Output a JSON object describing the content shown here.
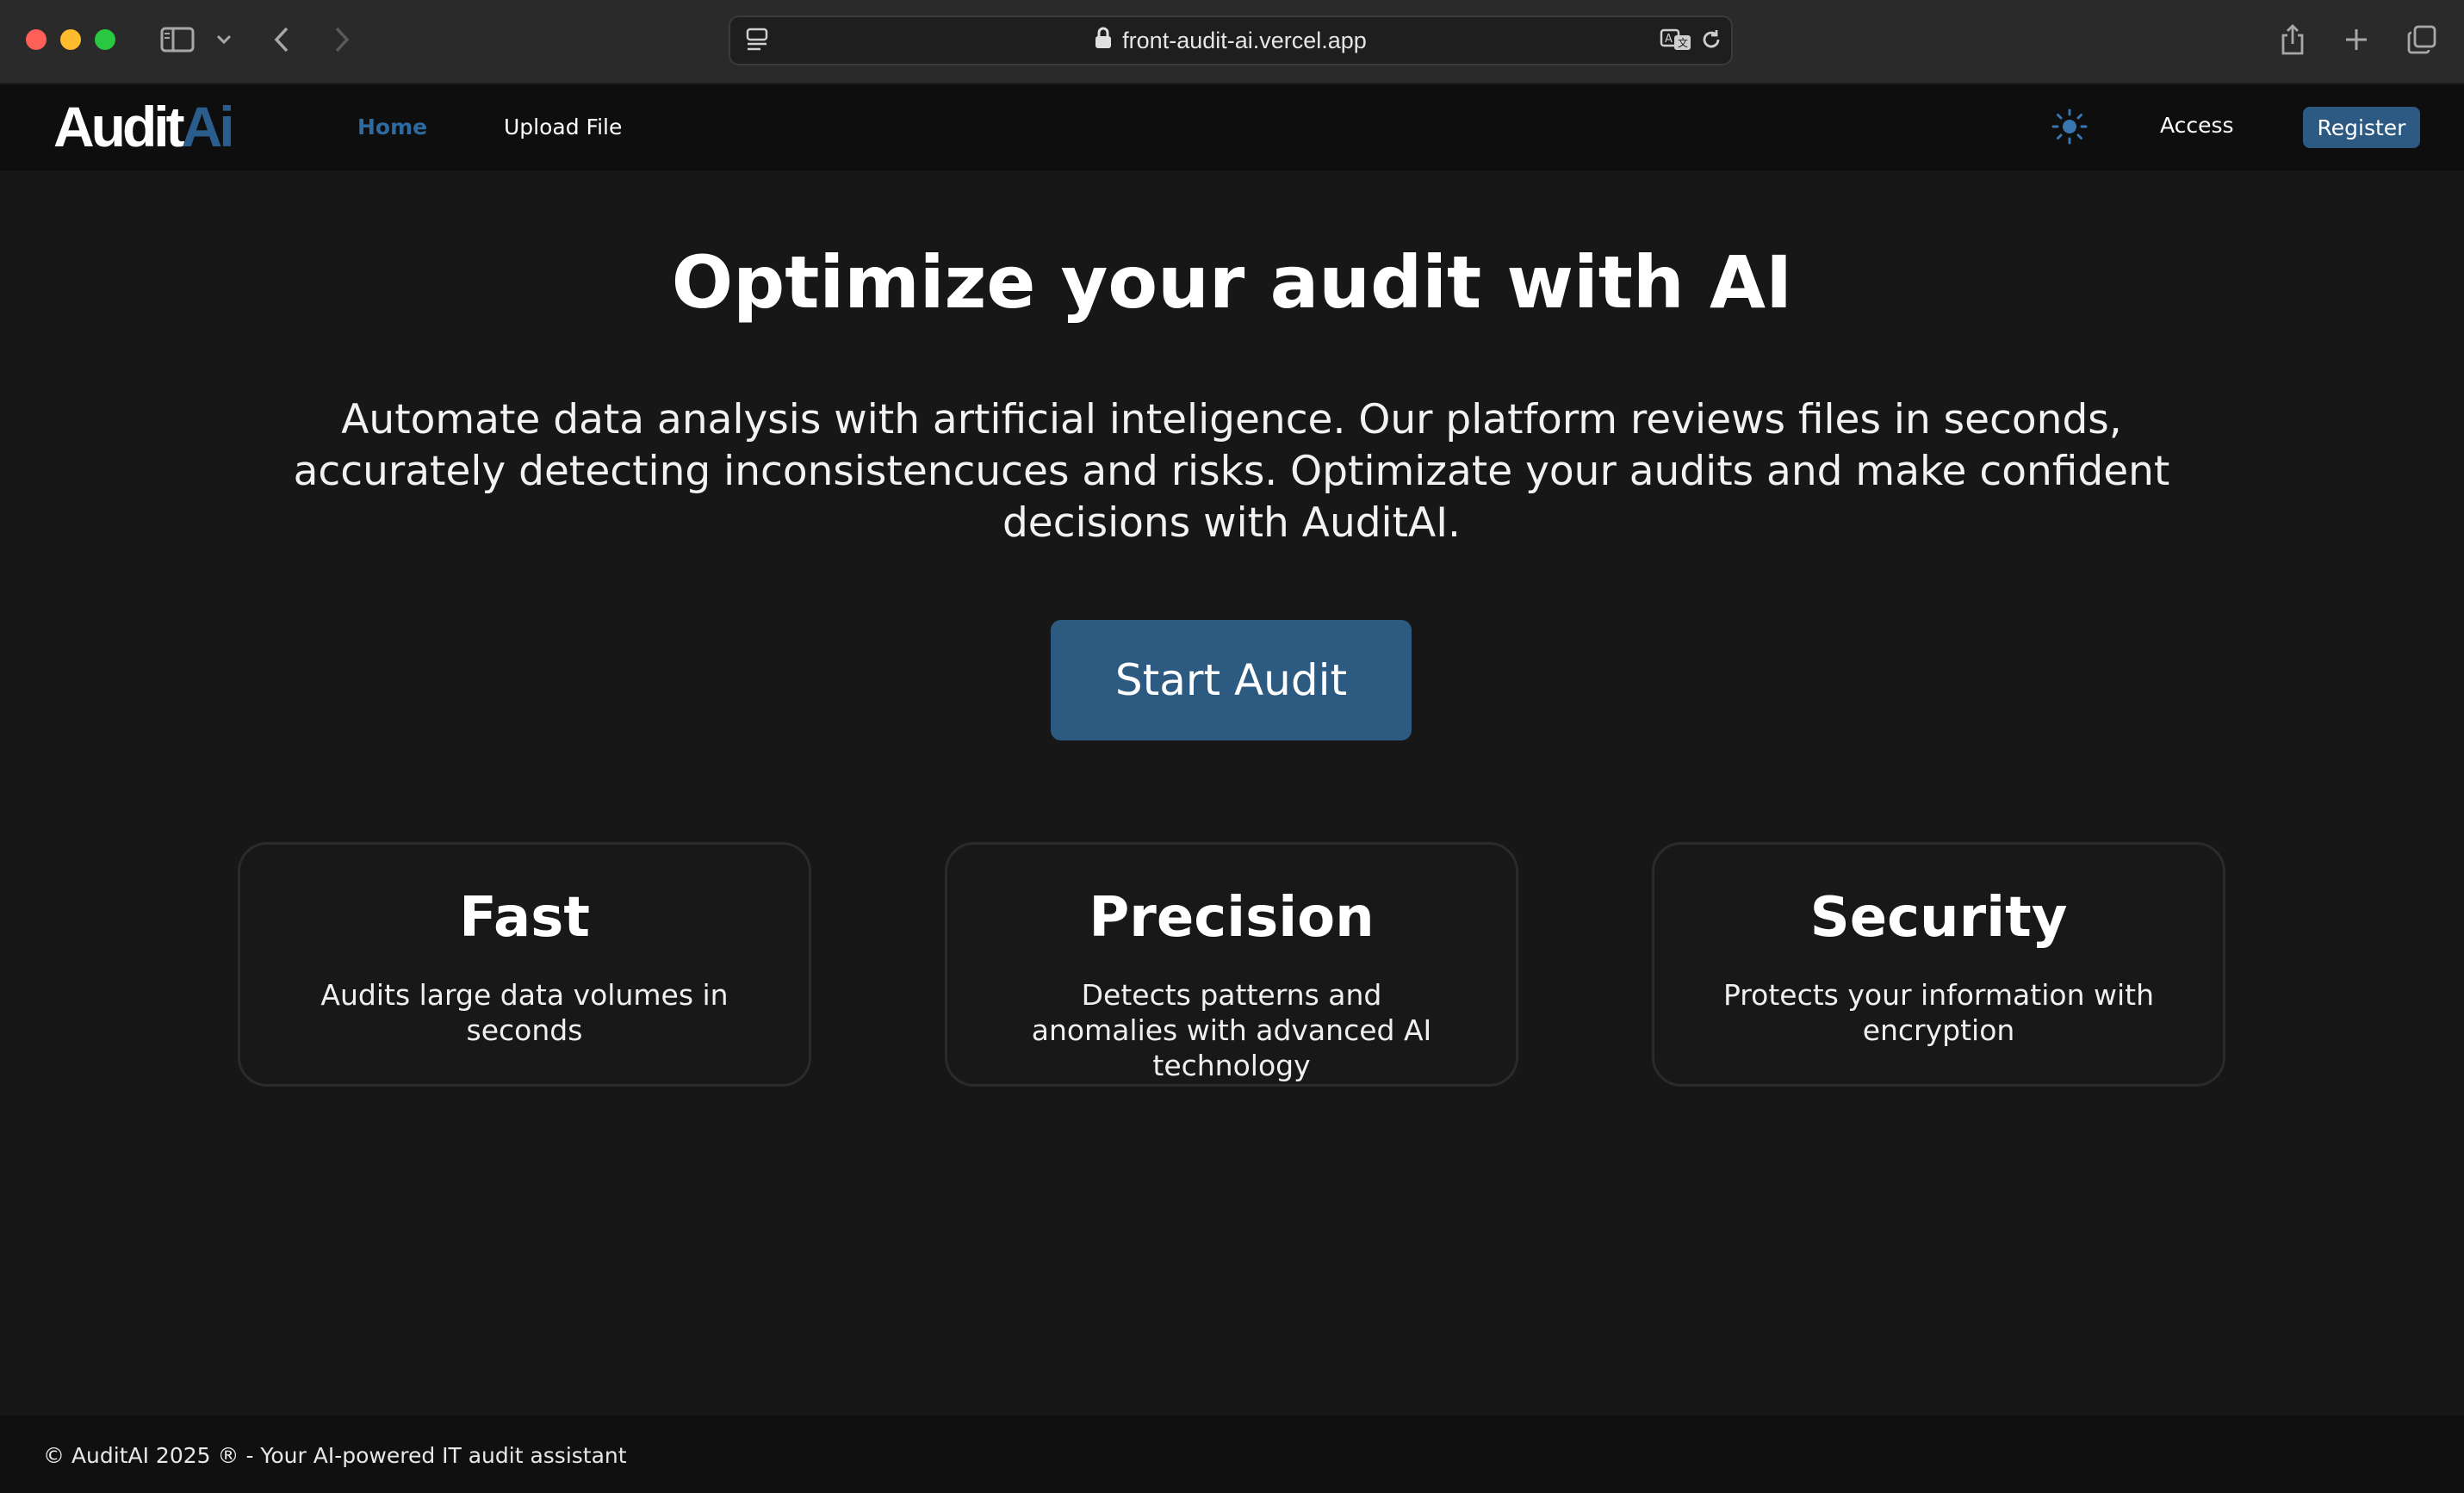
{
  "browser": {
    "url": "front-audit-ai.vercel.app"
  },
  "nav": {
    "logo_part1": "Audit",
    "logo_part2": "Ai",
    "home_label": "Home",
    "upload_label": "Upload File",
    "access_label": "Access",
    "register_label": "Register"
  },
  "hero": {
    "title": "Optimize your audit with AI",
    "line1": "Automate data analysis with artificial inteligence. Our platform reviews files in seconds,",
    "line2": "accurately detecting inconsistencuces and risks. Optimizate your audits and make confident",
    "line3": "decisions with AuditAI.",
    "cta_label": "Start Audit"
  },
  "features": [
    {
      "title": "Fast",
      "text": "Audits large data volumes in seconds"
    },
    {
      "title": "Precision",
      "text": "Detects patterns and anomalies with advanced AI technology"
    },
    {
      "title": "Security",
      "text": "Protects your information with encryption"
    }
  ],
  "footer": {
    "text": "© AuditAI 2025 ® - Your AI-powered IT audit assistant"
  },
  "colors": {
    "background": "#171717",
    "accent": "#2d5a80",
    "nav_active": "#2e6a9f"
  }
}
